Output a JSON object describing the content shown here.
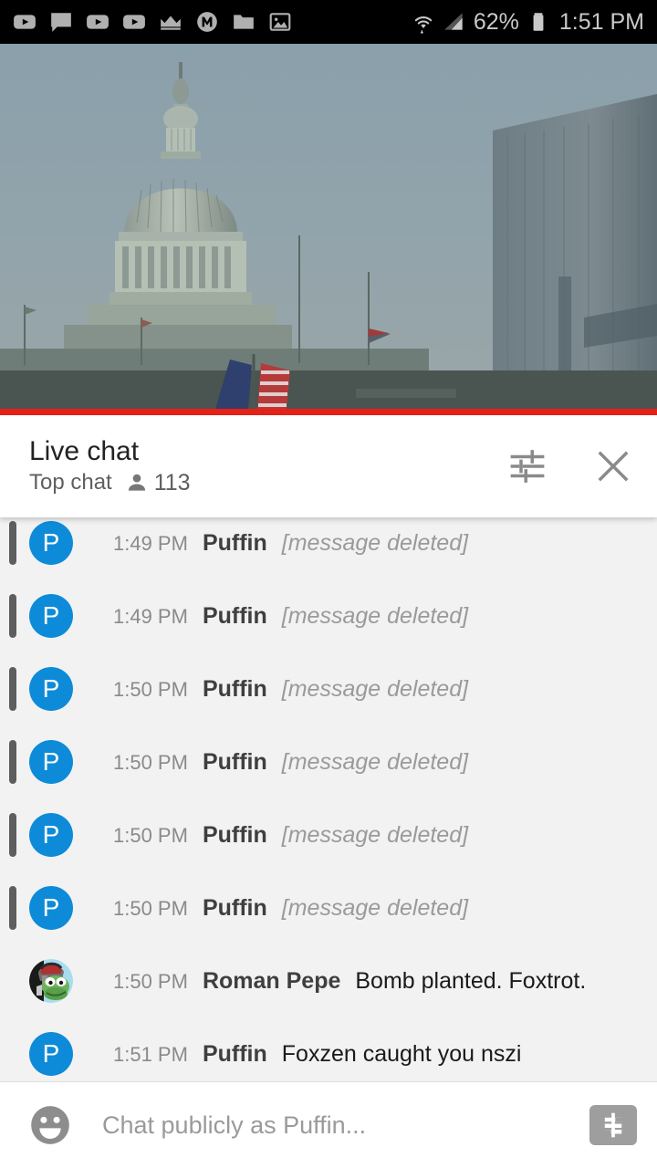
{
  "status_bar": {
    "icons": [
      "youtube-icon",
      "chat-bubble-icon",
      "youtube-icon",
      "youtube-icon",
      "crown-icon",
      "m-badge-icon",
      "folder-icon",
      "image-icon"
    ],
    "wifi_icon": "wifi-icon",
    "signal_icon": "cell-signal-icon",
    "battery_percent": "62%",
    "battery_icon": "battery-icon",
    "clock": "1:51 PM",
    "background_color": "#000000",
    "text_color": "#c9c9c9"
  },
  "video": {
    "description": "Live stream of the United States Capitol dome",
    "progress_percent": 100,
    "progress_color": "#e62117"
  },
  "chat_header": {
    "title": "Live chat",
    "subtitle": "Top chat",
    "viewer_icon": "person-icon",
    "viewer_count": "113",
    "settings_icon": "tune-icon",
    "close_icon": "close-icon"
  },
  "messages": [
    {
      "time": "1:49 PM",
      "author": "Puffin",
      "text": "[message deleted]",
      "deleted": true,
      "avatar_type": "letter",
      "avatar_letter": "P",
      "avatar_color": "#0d8bd9"
    },
    {
      "time": "1:49 PM",
      "author": "Puffin",
      "text": "[message deleted]",
      "deleted": true,
      "avatar_type": "letter",
      "avatar_letter": "P",
      "avatar_color": "#0d8bd9"
    },
    {
      "time": "1:50 PM",
      "author": "Puffin",
      "text": "[message deleted]",
      "deleted": true,
      "avatar_type": "letter",
      "avatar_letter": "P",
      "avatar_color": "#0d8bd9"
    },
    {
      "time": "1:50 PM",
      "author": "Puffin",
      "text": "[message deleted]",
      "deleted": true,
      "avatar_type": "letter",
      "avatar_letter": "P",
      "avatar_color": "#0d8bd9"
    },
    {
      "time": "1:50 PM",
      "author": "Puffin",
      "text": "[message deleted]",
      "deleted": true,
      "avatar_type": "letter",
      "avatar_letter": "P",
      "avatar_color": "#0d8bd9"
    },
    {
      "time": "1:50 PM",
      "author": "Puffin",
      "text": "[message deleted]",
      "deleted": true,
      "avatar_type": "letter",
      "avatar_letter": "P",
      "avatar_color": "#0d8bd9"
    },
    {
      "time": "1:50 PM",
      "author": "Roman Pepe",
      "text": "Bomb planted. Foxtrot.",
      "deleted": false,
      "avatar_type": "image",
      "avatar_alt": "pepe-roman-helmet-avatar"
    },
    {
      "time": "1:51 PM",
      "author": "Puffin",
      "text": "Foxzen caught you nszi",
      "deleted": false,
      "avatar_type": "letter",
      "avatar_letter": "P",
      "avatar_color": "#0d8bd9"
    }
  ],
  "input_bar": {
    "emoji_icon": "emoji-smiley-icon",
    "placeholder": "Chat publicly as Puffin...",
    "value": "",
    "superchat_icon": "dollar-icon"
  }
}
